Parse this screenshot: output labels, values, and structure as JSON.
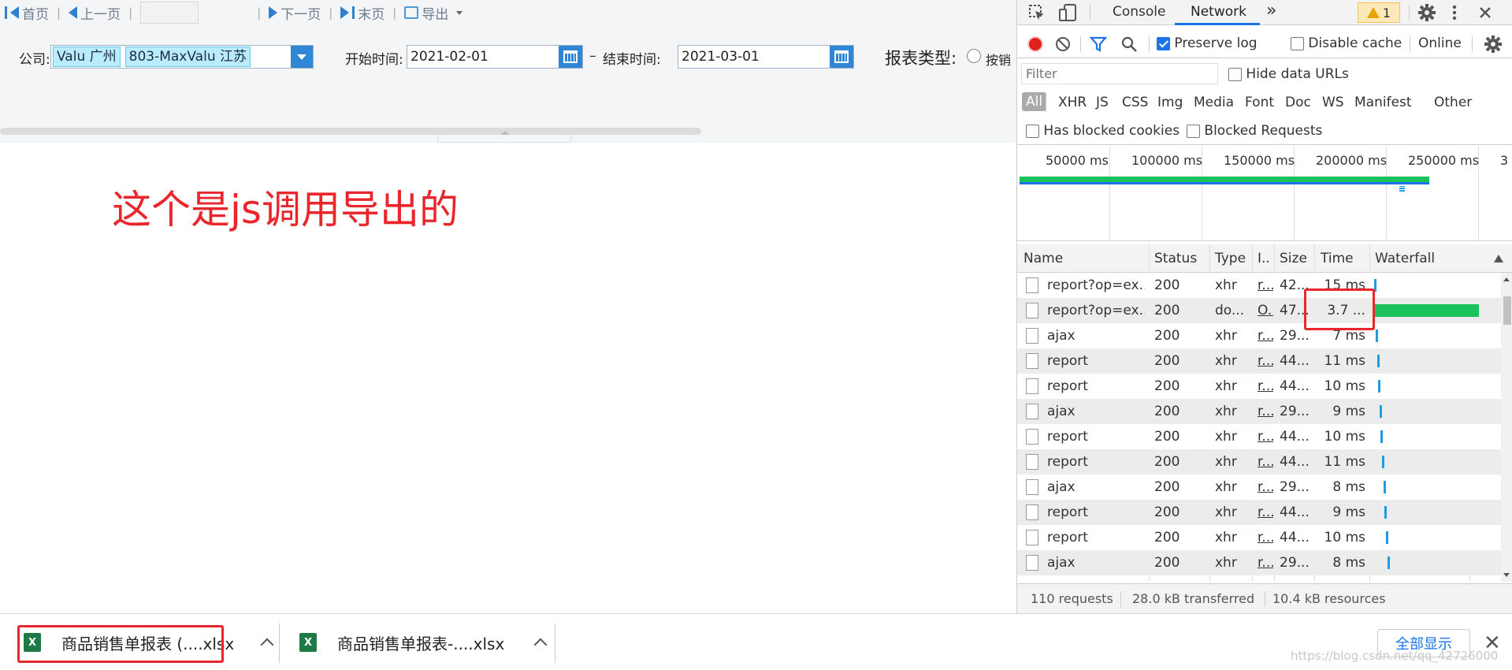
{
  "pager": {
    "first": "首页",
    "prev": "上一页",
    "next": "下一页",
    "last": "末页",
    "export": "导出"
  },
  "filters": {
    "company_label": "公司:",
    "company_tags": [
      "Valu 广州",
      "803-MaxValu 江苏"
    ],
    "start_label": "开始时间:",
    "start_value": "2021-02-01",
    "range_sep": "–",
    "end_label": "结束时间:",
    "end_value": "2021-03-01",
    "report_type_label": "报表类型:",
    "report_type_option": "按销"
  },
  "annotation": "这个是js调用导出的",
  "devtools": {
    "tabs": [
      "Console",
      "Network"
    ],
    "active_tab": "Network",
    "more_tabs": "»",
    "warnings_count": "1",
    "toolbar": {
      "preserve_log": "Preserve log",
      "preserve_log_checked": true,
      "disable_cache": "Disable cache",
      "disable_cache_checked": false,
      "throttle": "Online"
    },
    "filter": {
      "placeholder": "Filter",
      "hide_data_urls": "Hide data URLs"
    },
    "types": [
      "All",
      "XHR",
      "JS",
      "CSS",
      "Img",
      "Media",
      "Font",
      "Doc",
      "WS",
      "Manifest",
      "Other"
    ],
    "active_type": "All",
    "has_blocked_cookies": "Has blocked cookies",
    "blocked_requests": "Blocked Requests",
    "overview_ticks": [
      "50000 ms",
      "100000 ms",
      "150000 ms",
      "200000 ms",
      "250000 ms",
      "3"
    ],
    "columns": {
      "name": "Name",
      "status": "Status",
      "type": "Type",
      "initiator": "I..",
      "size": "Size",
      "time": "Time",
      "waterfall": "Waterfall"
    },
    "rows": [
      {
        "name": "report?op=ex...",
        "status": "200",
        "type": "xhr",
        "initiator": "r...",
        "size": "42...",
        "time": "15 ms"
      },
      {
        "name": "report?op=ex...",
        "status": "200",
        "type": "do...",
        "initiator": "O...",
        "size": "47...",
        "time": "3.7 ..."
      },
      {
        "name": "ajax",
        "status": "200",
        "type": "xhr",
        "initiator": "r...",
        "size": "29...",
        "time": "7 ms"
      },
      {
        "name": "report",
        "status": "200",
        "type": "xhr",
        "initiator": "r...",
        "size": "44...",
        "time": "11 ms"
      },
      {
        "name": "report",
        "status": "200",
        "type": "xhr",
        "initiator": "r...",
        "size": "44...",
        "time": "10 ms"
      },
      {
        "name": "ajax",
        "status": "200",
        "type": "xhr",
        "initiator": "r...",
        "size": "29...",
        "time": "9 ms"
      },
      {
        "name": "report",
        "status": "200",
        "type": "xhr",
        "initiator": "r...",
        "size": "44...",
        "time": "10 ms"
      },
      {
        "name": "report",
        "status": "200",
        "type": "xhr",
        "initiator": "r...",
        "size": "44...",
        "time": "11 ms"
      },
      {
        "name": "ajax",
        "status": "200",
        "type": "xhr",
        "initiator": "r...",
        "size": "29...",
        "time": "8 ms"
      },
      {
        "name": "report",
        "status": "200",
        "type": "xhr",
        "initiator": "r...",
        "size": "44...",
        "time": "9 ms"
      },
      {
        "name": "report",
        "status": "200",
        "type": "xhr",
        "initiator": "r...",
        "size": "44...",
        "time": "10 ms"
      },
      {
        "name": "ajax",
        "status": "200",
        "type": "xhr",
        "initiator": "r...",
        "size": "29...",
        "time": "8 ms"
      }
    ],
    "status_bar": {
      "requests": "110 requests",
      "transferred": "28.0 kB transferred",
      "resources": "10.4 kB resources"
    }
  },
  "downloads": {
    "items": [
      {
        "name": "商品销售单报表 (....xlsx"
      },
      {
        "name": "商品销售单报表-....xlsx"
      }
    ],
    "show_all": "全部显示",
    "close": "✕"
  },
  "watermark": "https://blog.csdn.net/qq_42726000",
  "colors": {
    "accent": "#1a73e8",
    "annotation_red": "#e8262b",
    "waterfall_green": "#1bc25a",
    "waterfall_blue": "#1e9be5"
  }
}
